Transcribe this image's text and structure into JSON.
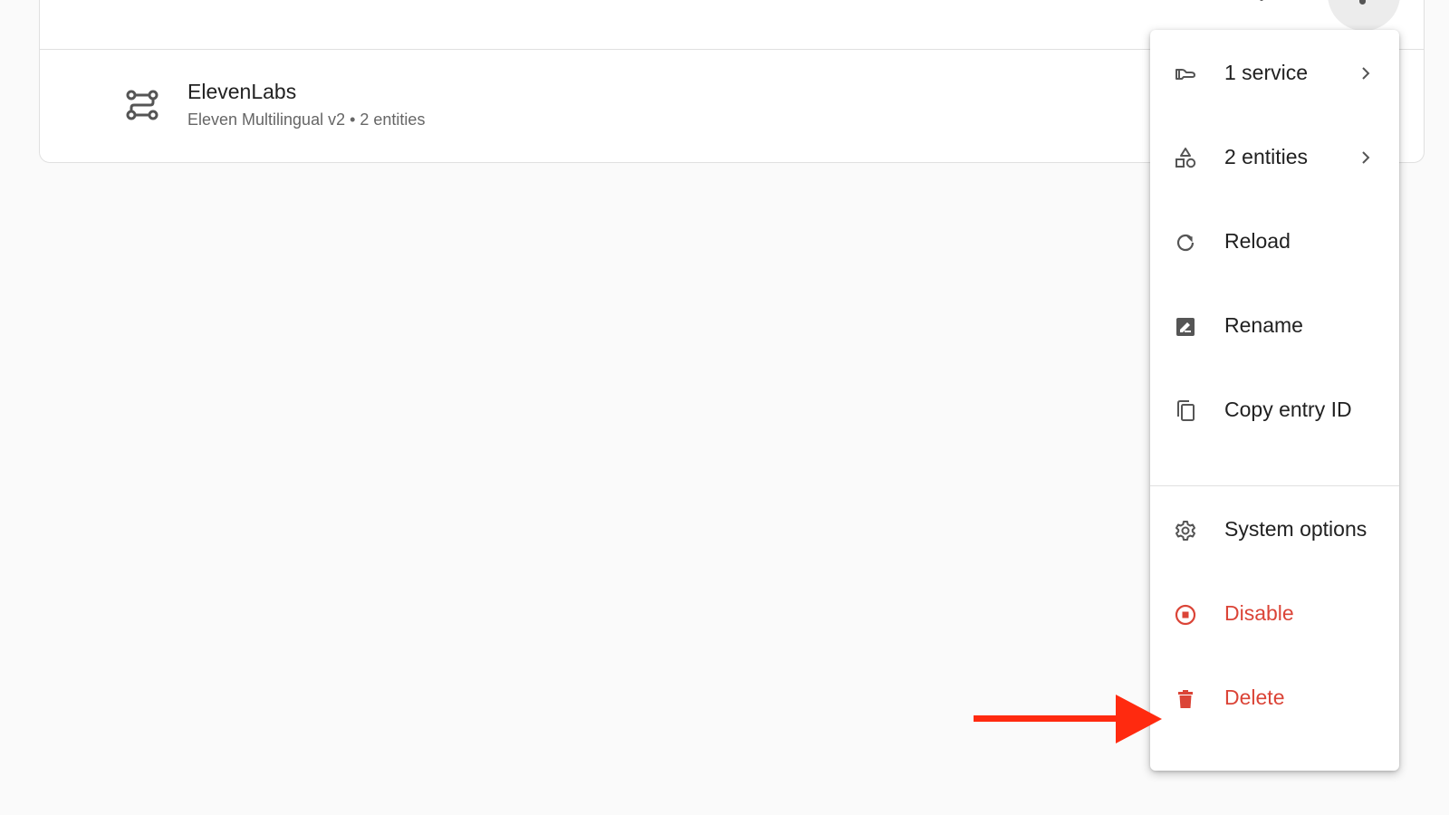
{
  "entry": {
    "title": "ElevenLabs",
    "subtitle": "Eleven Multilingual v2 • 2 entities",
    "icon": "integration-icon"
  },
  "header": {
    "settings_icon": "gear-icon",
    "overflow_icon": "more-vert-icon"
  },
  "menu": {
    "items": [
      {
        "label": "1 service",
        "icon": "service-icon",
        "has_submenu": true
      },
      {
        "label": "2 entities",
        "icon": "shapes-icon",
        "has_submenu": true
      },
      {
        "label": "Reload",
        "icon": "reload-icon"
      },
      {
        "label": "Rename",
        "icon": "rename-icon"
      },
      {
        "label": "Copy entry ID",
        "icon": "copy-icon"
      },
      {
        "label": "System options",
        "icon": "gear-icon"
      },
      {
        "label": "Disable",
        "icon": "stop-circle-icon",
        "danger": true
      },
      {
        "label": "Delete",
        "icon": "trash-icon",
        "danger": true
      }
    ]
  },
  "colors": {
    "danger": "#db4437",
    "annotation_arrow": "#ff2a0f",
    "text_primary": "#212121",
    "icon": "#555555"
  }
}
